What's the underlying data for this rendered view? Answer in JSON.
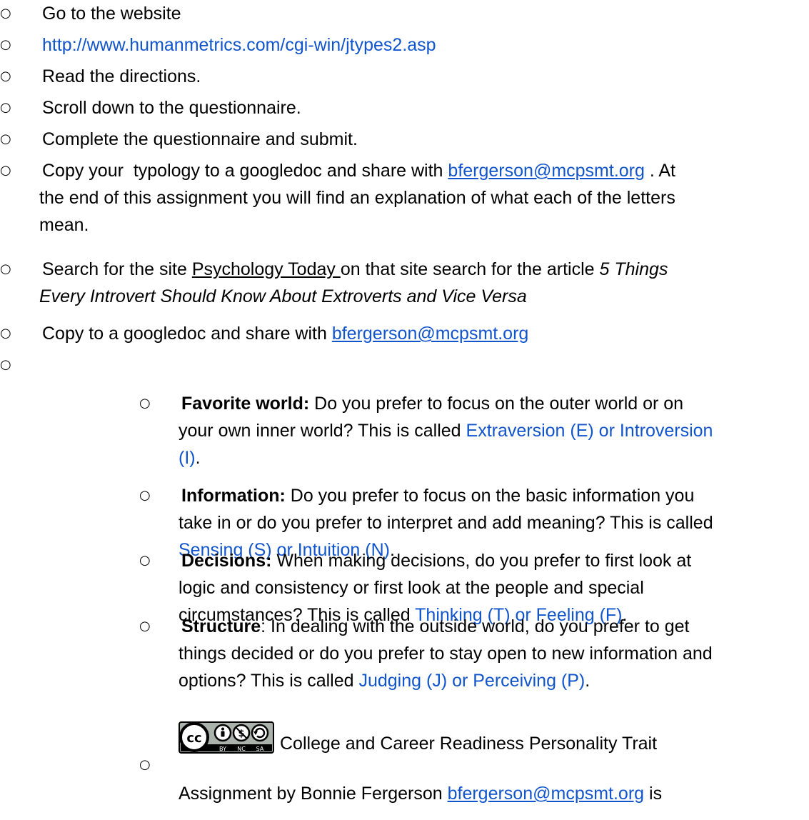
{
  "bullet": "○",
  "list1": {
    "i1": "Go to the website",
    "i2_link": "http://www.humanmetrics.com/cgi-win/jtypes2.asp",
    "i3": "Read the directions.",
    "i4": "Scroll down to the questionnaire.",
    "i5": "Complete the questionnaire and submit.",
    "i6_a": "Copy your  typology to a googledoc and share with ",
    "i6_email": "bfergerson@mcpsmt.org",
    "i6_b": " . At",
    "i6_l2": "the end of this assignment you will find an explanation of what each of the letters",
    "i6_l3": "mean.",
    "i7_a": "Search for the site ",
    "i7_site": "Psychology Today ",
    "i7_b": "on that site search for the article ",
    "i7_title1": "5 Things",
    "i7_title2": "Every Introvert Should Know About Extroverts and Vice Versa",
    "i8_a": "Copy to a googledoc and share with ",
    "i8_email": "bfergerson@mcpsmt.org"
  },
  "list2": {
    "fav_label": "Favorite world:",
    "fav_l1": " Do you prefer to focus on the outer world or on",
    "fav_l2a": "your own inner world? This is called ",
    "fav_link1": "Extraversion (E) or Introversion",
    "fav_link2": "(I)",
    "fav_end": ".",
    "info_label": "Information:",
    "info_l1": " Do you prefer to focus on the basic information you",
    "info_l2": "take in or do you prefer to interpret and add meaning? This is called",
    "info_link": "Sensing (S) or Intuition (N)",
    "info_end": ".",
    "dec_label": "Decisions:",
    "dec_l1": " When making decisions, do you prefer to first look at",
    "dec_l2": "logic and consistency or first look at the people and special",
    "dec_l3": "circumstances? This is called ",
    "dec_link": "Thinking (T) or Feeling (F)",
    "dec_end": ".",
    "str_label": "Structure",
    "str_l1": ": In dealing with the outside world, do you prefer to get",
    "str_l2": "things decided or do you prefer to stay open to new information and",
    "str_l3": "options? This is called ",
    "str_link": "Judging (J) or Perceiving (P)",
    "str_end": ".",
    "lic_l1": "College and Career Readiness Personality Trait",
    "lic_l2a": "Assignment by Bonnie Fergerson ",
    "lic_email": "bfergerson@mcpsmt.org",
    "lic_l2b": " is"
  },
  "cc_badge": {
    "cc": "cc",
    "by": "BY",
    "nc": "NC",
    "sa": "SA"
  }
}
